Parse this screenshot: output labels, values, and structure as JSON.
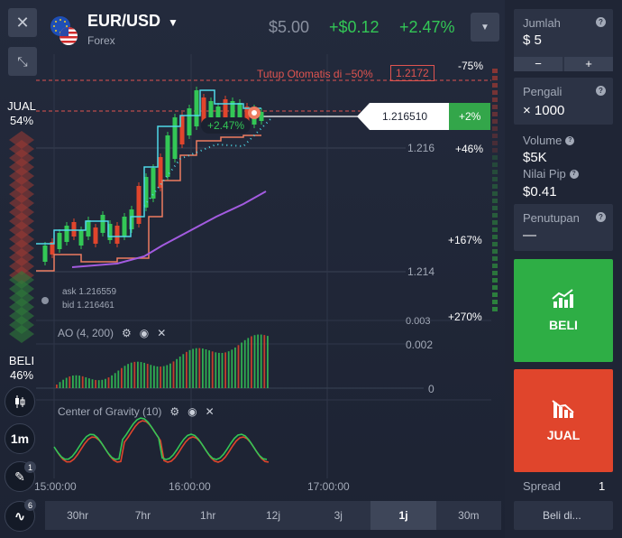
{
  "asset": {
    "name": "EUR/USD",
    "type": "Forex",
    "dropdown_icon": "caret-down-icon"
  },
  "header": {
    "investment": "$5.00",
    "profit": "+$0.12",
    "profit_pct": "+2.47%"
  },
  "left": {
    "sell_label": "JUAL",
    "sell_pct": "54%",
    "buy_label": "BELI",
    "buy_pct": "46%"
  },
  "chart": {
    "autoclose_text": "Tutup Otomatis di −50%",
    "autoclose_price": "1.2172",
    "current_price": "1.216510",
    "current_pct": "+2%",
    "trade_badge": "+2.47%",
    "price_ticks": [
      "1.216",
      "1.214"
    ],
    "pct_levels": [
      "-75%",
      "+46%",
      "+167%",
      "+270%"
    ],
    "ask": "ask 1.216559",
    "bid": "bid 1.216461",
    "time_labels": [
      "15:00:00",
      "16:00:00",
      "17:00:00"
    ]
  },
  "indicators": {
    "ao": {
      "label": "AO (4, 200)",
      "ticks": [
        "0.003",
        "0.002",
        "0"
      ]
    },
    "cog": {
      "label": "Center of Gravity (10)"
    }
  },
  "tools": {
    "timeframe": "1m",
    "draw_badge": "1",
    "indicator_badge": "6"
  },
  "timeframes": [
    "30hr",
    "7hr",
    "1hr",
    "12j",
    "3j",
    "1j",
    "30m"
  ],
  "active_timeframe": "1j",
  "panel": {
    "amount_label": "Jumlah",
    "amount_value": "$ 5",
    "minus": "−",
    "plus": "+",
    "multiplier_label": "Pengali",
    "multiplier_value": "× 1000",
    "volume_label": "Volume",
    "volume_value": "$5K",
    "pip_label": "Nilai Pip",
    "pip_value": "$0.41",
    "close_label": "Penutupan",
    "close_value": "—",
    "buy_button": "BELI",
    "sell_button": "JUAL",
    "spread_label": "Spread",
    "spread_value": "1",
    "buy_at": "Beli di..."
  },
  "colors": {
    "buy": "#2eae45",
    "sell": "#e0452c",
    "accent_green": "#33c756",
    "autoclose_red": "#e05450"
  }
}
